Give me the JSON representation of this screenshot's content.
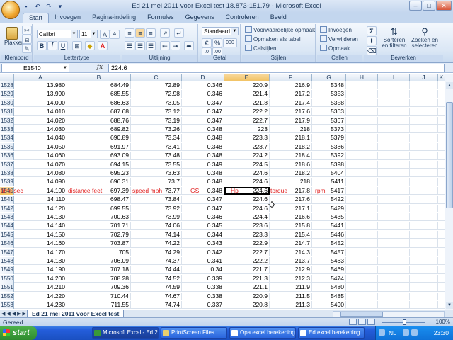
{
  "title": "Ed 21 mei 2011 voor Excel test 18.873-151.79 - Microsoft Excel",
  "ribbon": {
    "tabs": [
      "Start",
      "Invoegen",
      "Pagina-indeling",
      "Formules",
      "Gegevens",
      "Controleren",
      "Beeld"
    ],
    "clipboard": {
      "label": "Klembord",
      "paste": "Plakken"
    },
    "font": {
      "label": "Lettertype",
      "name": "Calibri",
      "size": "11",
      "bold": "B",
      "italic": "I",
      "underline": "U"
    },
    "alignment": {
      "label": "Uitlijning"
    },
    "number": {
      "label": "Getal",
      "format": "Standaard",
      "percent": "%",
      "thousands": "000"
    },
    "styles": {
      "label": "Stijlen",
      "conditional": "Voorwaardelijke opmaak",
      "as_table": "Opmaken als tabel",
      "cell_styles": "Celstijlen"
    },
    "cells": {
      "label": "Cellen",
      "insert": "Invoegen",
      "delete": "Verwijderen",
      "format": "Opmaak"
    },
    "editing": {
      "label": "Bewerken",
      "sum": "Σ",
      "sort": "Sorteren en filteren",
      "find": "Zoeken en selecteren"
    }
  },
  "formula": {
    "namebox": "E1540",
    "fx": "fx",
    "value": "224.6"
  },
  "columns": [
    "A",
    "B",
    "C",
    "D",
    "E",
    "F",
    "G",
    "H",
    "I",
    "J",
    "K"
  ],
  "active_cell": "E1540",
  "labels": {
    "time": "time sec",
    "distance": "distance feet",
    "speed": "speed mph",
    "gs": "GS",
    "hp": "Hp",
    "torque": "torque",
    "rpm": "rpm"
  },
  "rows": [
    {
      "n": "1528",
      "a": "13.980",
      "b": "684.49",
      "c": "72.89",
      "d": "0.346",
      "e": "220.9",
      "f": "216.9",
      "g": "5348"
    },
    {
      "n": "1529",
      "a": "13.990",
      "b": "685.55",
      "c": "72.98",
      "d": "0.346",
      "e": "221.4",
      "f": "217.2",
      "g": "5353"
    },
    {
      "n": "1530",
      "a": "14.000",
      "b": "686.63",
      "c": "73.05",
      "d": "0.347",
      "e": "221.8",
      "f": "217.4",
      "g": "5358"
    },
    {
      "n": "1531",
      "a": "14.010",
      "b": "687.68",
      "c": "73.12",
      "d": "0.347",
      "e": "222.2",
      "f": "217.6",
      "g": "5363"
    },
    {
      "n": "1532",
      "a": "14.020",
      "b": "688.76",
      "c": "73.19",
      "d": "0.347",
      "e": "222.7",
      "f": "217.9",
      "g": "5367"
    },
    {
      "n": "1533",
      "a": "14.030",
      "b": "689.82",
      "c": "73.26",
      "d": "0.348",
      "e": "223",
      "f": "218",
      "g": "5373"
    },
    {
      "n": "1534",
      "a": "14.040",
      "b": "690.89",
      "c": "73.34",
      "d": "0.348",
      "e": "223.3",
      "f": "218.1",
      "g": "5379"
    },
    {
      "n": "1535",
      "a": "14.050",
      "b": "691.97",
      "c": "73.41",
      "d": "0.348",
      "e": "223.7",
      "f": "218.2",
      "g": "5386"
    },
    {
      "n": "1536",
      "a": "14.060",
      "b": "693.09",
      "c": "73.48",
      "d": "0.348",
      "e": "224.2",
      "f": "218.4",
      "g": "5392"
    },
    {
      "n": "1537",
      "a": "14.070",
      "b": "694.15",
      "c": "73.55",
      "d": "0.349",
      "e": "224.5",
      "f": "218.6",
      "g": "5398"
    },
    {
      "n": "1538",
      "a": "14.080",
      "b": "695.23",
      "c": "73.63",
      "d": "0.348",
      "e": "224.6",
      "f": "218.2",
      "g": "5404"
    },
    {
      "n": "1539",
      "a": "14.090",
      "b": "696.31",
      "c": "73.7",
      "d": "0.348",
      "e": "224.6",
      "f": "218",
      "g": "5411"
    },
    {
      "n": "1540",
      "a": "14.100",
      "b": "697.39",
      "c": "73.77",
      "d": "0.348",
      "e": "224.6",
      "f": "217.8",
      "g": "5417",
      "labeled": true
    },
    {
      "n": "1541",
      "a": "14.110",
      "b": "698.47",
      "c": "73.84",
      "d": "0.347",
      "e": "224.6",
      "f": "217.6",
      "g": "5422"
    },
    {
      "n": "1542",
      "a": "14.120",
      "b": "699.55",
      "c": "73.92",
      "d": "0.347",
      "e": "224.6",
      "f": "217.1",
      "g": "5429"
    },
    {
      "n": "1543",
      "a": "14.130",
      "b": "700.63",
      "c": "73.99",
      "d": "0.346",
      "e": "224.4",
      "f": "216.6",
      "g": "5435"
    },
    {
      "n": "1544",
      "a": "14.140",
      "b": "701.71",
      "c": "74.06",
      "d": "0.345",
      "e": "223.6",
      "f": "215.8",
      "g": "5441"
    },
    {
      "n": "1545",
      "a": "14.150",
      "b": "702.79",
      "c": "74.14",
      "d": "0.344",
      "e": "223.3",
      "f": "215.4",
      "g": "5446"
    },
    {
      "n": "1546",
      "a": "14.160",
      "b": "703.87",
      "c": "74.22",
      "d": "0.343",
      "e": "222.9",
      "f": "214.7",
      "g": "5452"
    },
    {
      "n": "1547",
      "a": "14.170",
      "b": "705",
      "c": "74.29",
      "d": "0.342",
      "e": "222.7",
      "f": "214.3",
      "g": "5457"
    },
    {
      "n": "1548",
      "a": "14.180",
      "b": "706.09",
      "c": "74.37",
      "d": "0.341",
      "e": "222.2",
      "f": "213.7",
      "g": "5463"
    },
    {
      "n": "1549",
      "a": "14.190",
      "b": "707.18",
      "c": "74.44",
      "d": "0.34",
      "e": "221.7",
      "f": "212.9",
      "g": "5469"
    },
    {
      "n": "1550",
      "a": "14.200",
      "b": "708.28",
      "c": "74.52",
      "d": "0.339",
      "e": "221.3",
      "f": "212.3",
      "g": "5474"
    },
    {
      "n": "1551",
      "a": "14.210",
      "b": "709.36",
      "c": "74.59",
      "d": "0.338",
      "e": "221.1",
      "f": "211.9",
      "g": "5480"
    },
    {
      "n": "1552",
      "a": "14.220",
      "b": "710.44",
      "c": "74.67",
      "d": "0.338",
      "e": "220.9",
      "f": "211.5",
      "g": "5485"
    },
    {
      "n": "1553",
      "a": "14.230",
      "b": "711.55",
      "c": "74.74",
      "d": "0.337",
      "e": "220.8",
      "f": "211.3",
      "g": "5490"
    }
  ],
  "sheet": {
    "tab": "Ed 21 mei 2011 voor Excel test"
  },
  "status": {
    "text": "Gereed",
    "zoom": "100%"
  },
  "taskbar": {
    "start": "start",
    "items": [
      "Microsoft Excel - Ed 2...",
      "PrintScreen Files",
      "Opa excel berekening...",
      "Ed excel berekening..."
    ],
    "lang": "NL",
    "clock": "23:30"
  }
}
